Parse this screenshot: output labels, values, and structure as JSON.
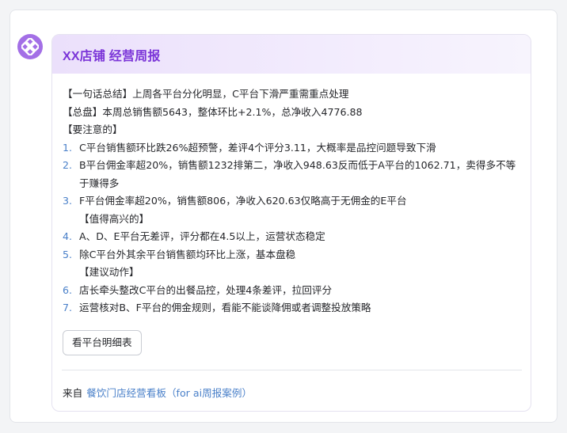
{
  "card": {
    "title": "XX店铺 经营周报",
    "summary_line": "【一句话总结】上周各平台分化明显，C平台下滑严重需重点处理",
    "overview_line": "【总盘】本周总销售额5643，整体环比+2.1%，总净收入4776.88",
    "attention_heading": "【要注意的】",
    "attention_items": [
      {
        "num": "1.",
        "text": "C平台销售额环比跌26%超预警，差评4个评分3.11，大概率是品控问题导致下滑"
      },
      {
        "num": "2.",
        "text": "B平台佣金率超20%，销售额1232排第二，净收入948.63反而低于A平台的1062.71，卖得多不等于赚得多"
      },
      {
        "num": "3.",
        "text": "F平台佣金率超20%，销售额806，净收入620.63仅略高于无佣金的E平台"
      }
    ],
    "highlight_heading": "【值得高兴的】",
    "highlight_items": [
      {
        "num": "4.",
        "text": "A、D、E平台无差评，评分都在4.5以上，运营状态稳定"
      },
      {
        "num": "5.",
        "text": "除C平台外其余平台销售额均环比上涨，基本盘稳"
      }
    ],
    "action_heading": "【建议动作】",
    "action_items": [
      {
        "num": "6.",
        "text": "店长牵头整改C平台的出餐品控，处理4条差评，拉回评分"
      },
      {
        "num": "7.",
        "text": "运营核对B、F平台的佣金规则，看能不能谈降佣或者调整投放策略"
      }
    ],
    "detail_button_label": "看平台明细表",
    "source_prefix": "来自",
    "source_link": "餐饮门店经营看板（for ai周报案例）"
  },
  "colors": {
    "accent": "#7b35d8",
    "avatar_bg": "#a36fe6",
    "link": "#4a80c9"
  },
  "icons": {
    "avatar": "ai-assistant-logo-icon"
  }
}
